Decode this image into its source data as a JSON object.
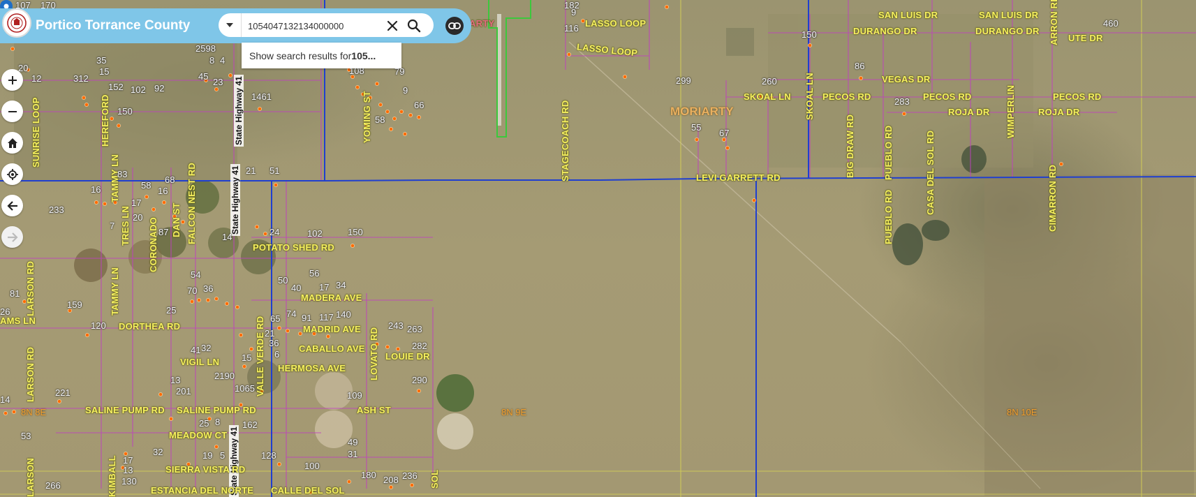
{
  "header": {
    "app_title": "Portico Torrance County",
    "search_value": "1054047132134000000",
    "suggestion_prefix": "Show search results for ",
    "suggestion_bold": "105..."
  },
  "map": {
    "town_label": "MORIARTY",
    "top_fragment": "ARTY",
    "township_labels": [
      "8N 8E",
      "8N 9E",
      "8N 10E"
    ],
    "highway_label": "State Highway 41",
    "road_labels": [
      "SAN LUIS DR",
      "SAN LUIS DR",
      "DURANGO DR",
      "DURANGO DR",
      "UTE DR",
      "LASSO LOOP",
      "LASSO LOOP",
      "VEGAS DR",
      "PECOS RD",
      "PECOS RD",
      "PECOS RD",
      "SKOAL LN",
      "ROJA DR",
      "ROJA DR",
      "LEVI GARRETT RD",
      "POTATO SHED RD",
      "MADERA AVE",
      "DORTHEA RD",
      "MADRID AVE",
      "CABALLO AVE",
      "LOUIE DR",
      "HERMOSA AVE",
      "VIGIL LN",
      "AMS LN",
      "ASH ST",
      "SALINE PUMP RD",
      "SALINE PUMP RD",
      "MEADOW CT",
      "SIERRA VISTA RD",
      "ESTANCIA DEL NORTE",
      "CALLE DEL SOL"
    ],
    "vertical_road_labels": [
      "SUNRISE LOOP",
      "STAGECOACH RD",
      "SKOAL LN",
      "BIG DRAW RD",
      "PUEBLO RD",
      "PUEBLO RD",
      "CASA DEL SOL RD",
      "WIMPERLIN",
      "CIMARRON RD",
      "ARRON RD",
      "LARSON RD",
      "LARSON RD",
      "LARSON",
      "FALCON NEST RD",
      "VALLE VERDE RD",
      "LOVATO RD",
      "YOMING ST",
      "TAMMY LN",
      "TAMMY LN",
      "DAN ST",
      "CORONADO",
      "HEREFORD",
      "TRES LN",
      "KIMBALL",
      "SOL"
    ],
    "parcel_numbers": [
      "107",
      "170",
      "182",
      "460",
      "150",
      "35",
      "2598",
      "8",
      "4",
      "20",
      "312",
      "15",
      "12",
      "152",
      "102",
      "92",
      "45",
      "23",
      "1461",
      "299",
      "260",
      "86",
      "283",
      "150",
      "55",
      "67",
      "21",
      "51",
      "83",
      "68",
      "16",
      "58",
      "16",
      "17",
      "233",
      "20",
      "7",
      "87",
      "14",
      "24",
      "102",
      "150",
      "54",
      "70",
      "36",
      "50",
      "40",
      "56",
      "17",
      "34",
      "81",
      "159",
      "25",
      "26",
      "120",
      "65",
      "74",
      "91",
      "117",
      "140",
      "243",
      "263",
      "41",
      "32",
      "21",
      "36",
      "6",
      "282",
      "15",
      "13",
      "2190",
      "290",
      "201",
      "221",
      "1065",
      "109",
      "14",
      "25",
      "8",
      "162",
      "53",
      "49",
      "31",
      "32",
      "19",
      "5",
      "128",
      "100",
      "180",
      "208",
      "236",
      "266",
      "17",
      "13",
      "130",
      "9",
      "116",
      "9",
      "66",
      "108",
      "79",
      "58"
    ]
  },
  "colors": {
    "header_bg": "#7fc6e8",
    "road_label": "#f6f060",
    "parcel_line": "#c040c0",
    "main_road": "#1f3fd0",
    "section_line": "#d9d455",
    "city_limit": "#3cc83c",
    "parcel_dot": "#ff6a00"
  },
  "icons": {
    "logo": "county-seal-icon",
    "dropdown": "caret-down-icon",
    "clear": "close-icon",
    "search": "search-icon",
    "link": "link-icon",
    "zoom_in": "plus-icon",
    "zoom_out": "minus-icon",
    "home": "home-icon",
    "locate": "locate-icon",
    "back": "arrow-left-icon",
    "forward": "arrow-right-icon",
    "pin": "map-pin-icon"
  }
}
